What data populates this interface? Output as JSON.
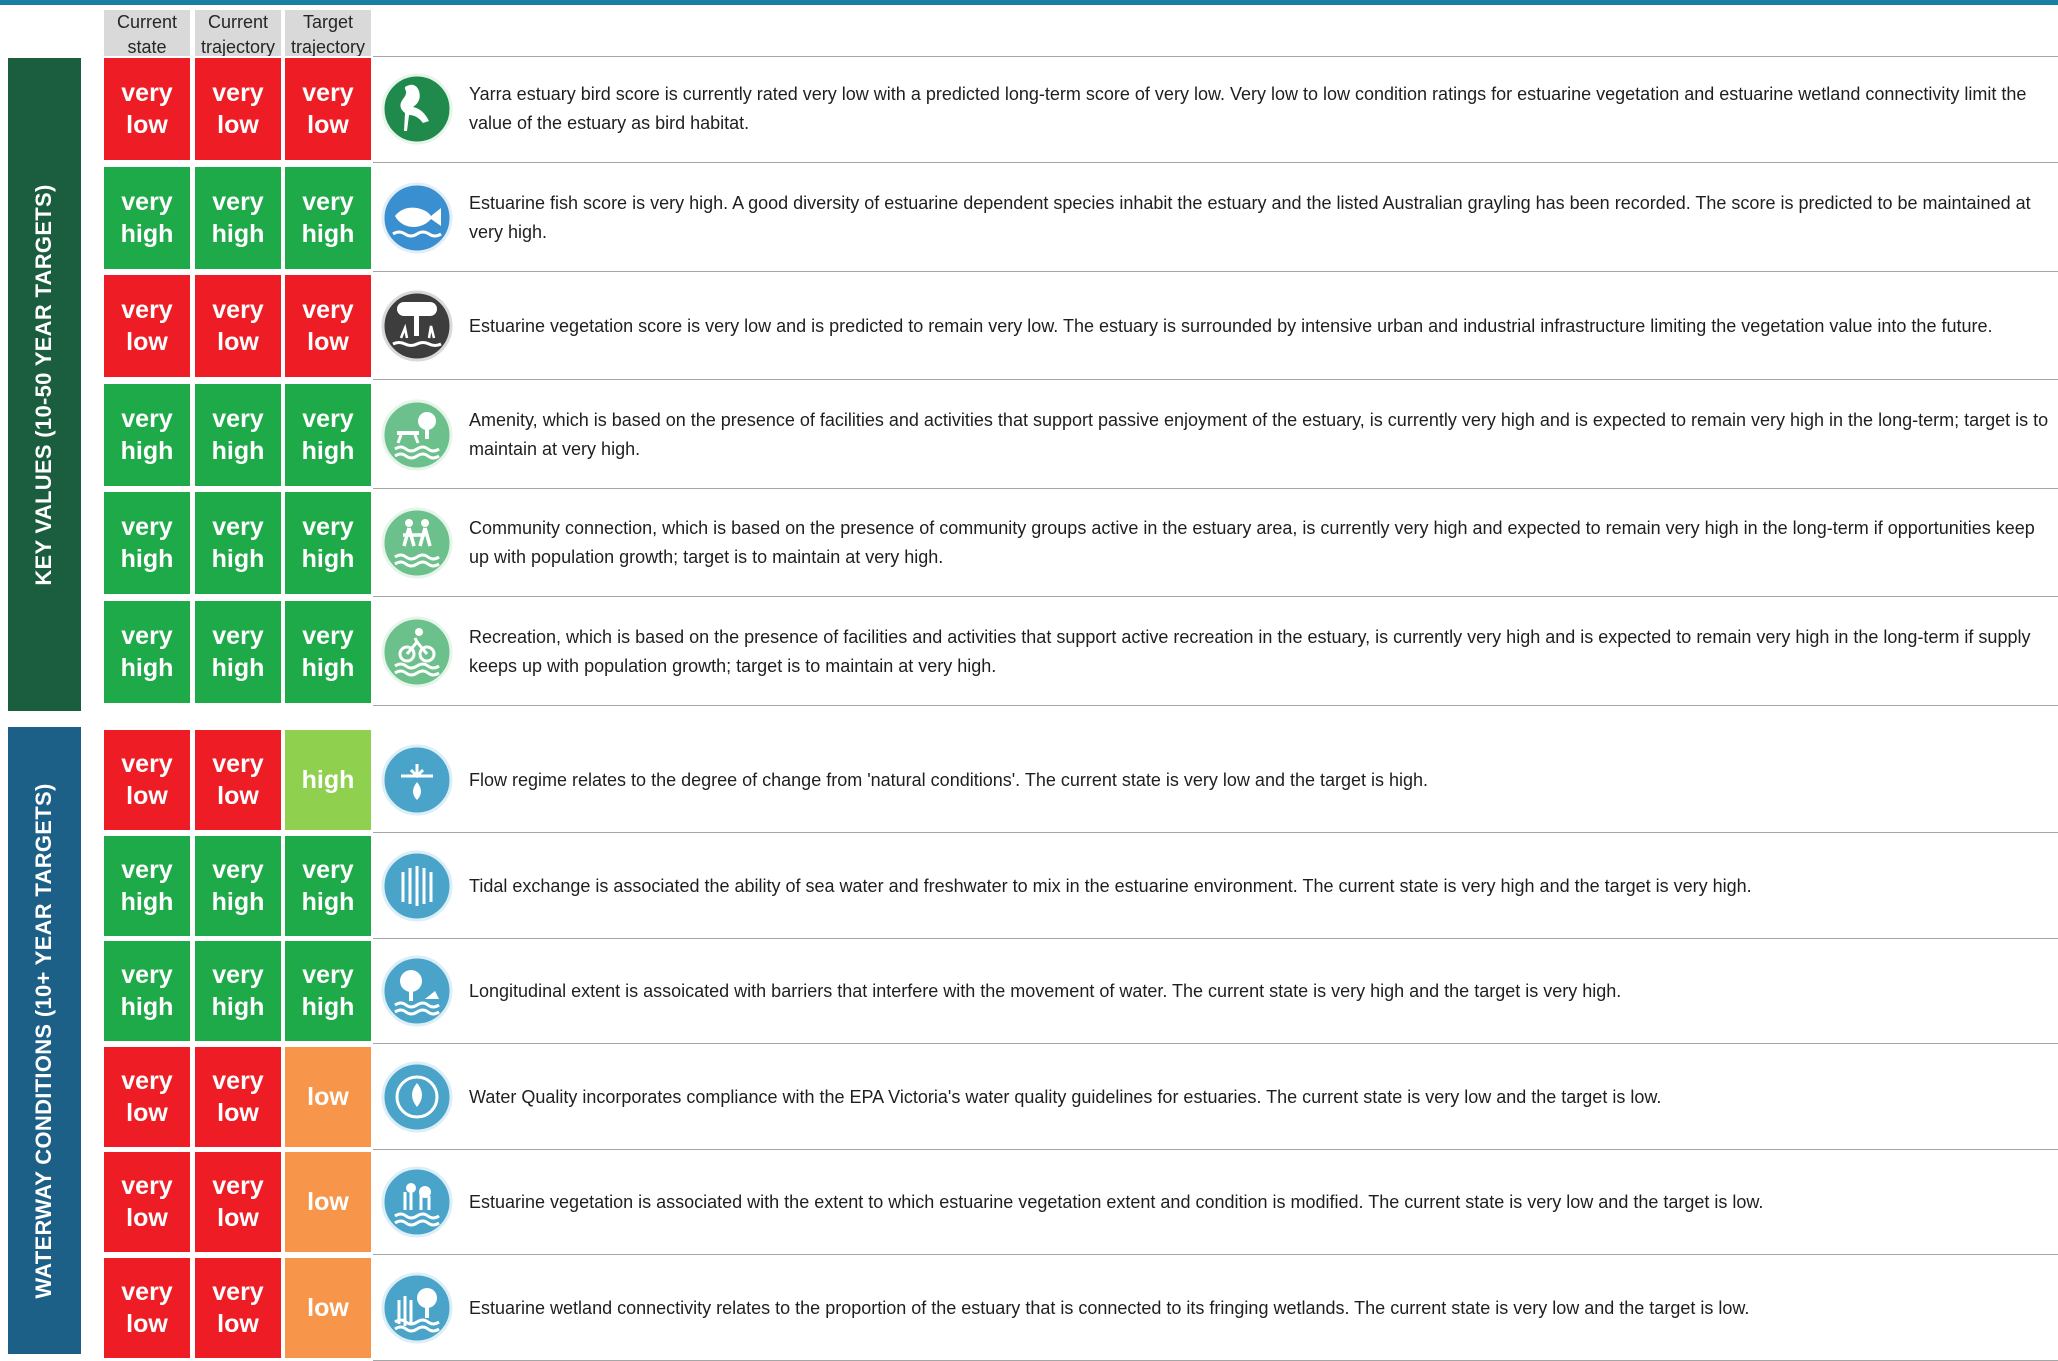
{
  "colors": {
    "top_bar": "#1a7fa0",
    "band_key_values": "#1b5e3f",
    "band_waterway": "#1c5f87",
    "very_low": "#ee1c24",
    "low": "#f7964a",
    "high": "#8fd14f",
    "very_high": "#1faa4a"
  },
  "headers": [
    {
      "label": "Current\nstate"
    },
    {
      "label": "Current\ntrajectory"
    },
    {
      "label": "Target\ntrajectory"
    }
  ],
  "sections": [
    {
      "label": "KEY VALUES (10-50 YEAR TARGETS)",
      "rows": [
        {
          "icon": "heron-bird-icon",
          "ratings": [
            "very\nlow",
            "very\nlow",
            "very\nlow"
          ],
          "levels": [
            "very_low",
            "very_low",
            "very_low"
          ],
          "text": "Yarra estuary bird score is currently rated very low with a predicted long-term score of very low. Very low to low condition ratings for estuarine vegetation and estuarine wetland connectivity limit the value of the estuary as bird habitat."
        },
        {
          "icon": "fish-icon",
          "ratings": [
            "very\nhigh",
            "very\nhigh",
            "very\nhigh"
          ],
          "levels": [
            "very_high",
            "very_high",
            "very_high"
          ],
          "text": "Estuarine fish score is very high. A good diversity of estuarine dependent species inhabit the estuary and the listed Australian grayling has been recorded. The score is predicted to be maintained at very high."
        },
        {
          "icon": "vegetation-tree-icon",
          "ratings": [
            "very\nlow",
            "very\nlow",
            "very\nlow"
          ],
          "levels": [
            "very_low",
            "very_low",
            "very_low"
          ],
          "text": "Estuarine vegetation score is very low and is predicted to remain very low. The estuary is surrounded by intensive urban and industrial infrastructure limiting the vegetation value into the future."
        },
        {
          "icon": "picnic-amenity-icon",
          "ratings": [
            "very\nhigh",
            "very\nhigh",
            "very\nhigh"
          ],
          "levels": [
            "very_high",
            "very_high",
            "very_high"
          ],
          "text": "Amenity, which is based on the presence of facilities and activities that support passive enjoyment of the estuary, is currently very high and is expected to remain very high in the long-term; target is to maintain at very high."
        },
        {
          "icon": "people-walking-icon",
          "ratings": [
            "very\nhigh",
            "very\nhigh",
            "very\nhigh"
          ],
          "levels": [
            "very_high",
            "very_high",
            "very_high"
          ],
          "text": "Community connection, which is based on the presence of community groups active in the estuary area, is currently very high and expected to remain very high in the long-term if opportunities keep up with population growth; target is to maintain at very high."
        },
        {
          "icon": "cyclist-icon",
          "ratings": [
            "very\nhigh",
            "very\nhigh",
            "very\nhigh"
          ],
          "levels": [
            "very_high",
            "very_high",
            "very_high"
          ],
          "text": "Recreation, which is based on the presence of facilities and activities that support active recreation in the estuary, is currently very high and is expected to remain very high in the long-term if supply keeps up with population growth; target is to maintain at very high."
        }
      ]
    },
    {
      "label": "WATERWAY CONDITIONS (10+ YEAR TARGETS)",
      "rows": [
        {
          "icon": "flow-regime-icon",
          "ratings": [
            "very\nlow",
            "very\nlow",
            "high"
          ],
          "levels": [
            "very_low",
            "very_low",
            "high"
          ],
          "text": "Flow regime relates to the degree of change from 'natural conditions'.  The current state is very low and the target is high."
        },
        {
          "icon": "tidal-exchange-icon",
          "ratings": [
            "very\nhigh",
            "very\nhigh",
            "very\nhigh"
          ],
          "levels": [
            "very_high",
            "very_high",
            "very_high"
          ],
          "text": "Tidal exchange is associated the ability of sea water and freshwater to mix in the estuarine environment. The current state is very high and the target is very high."
        },
        {
          "icon": "longitudinal-extent-icon",
          "ratings": [
            "very\nhigh",
            "very\nhigh",
            "very\nhigh"
          ],
          "levels": [
            "very_high",
            "very_high",
            "very_high"
          ],
          "text": "Longitudinal extent is assoicated with barriers that interfere with the movement of water.  The current state is very high and the target is very high."
        },
        {
          "icon": "water-drop-icon",
          "ratings": [
            "very\nlow",
            "very\nlow",
            "low"
          ],
          "levels": [
            "very_low",
            "very_low",
            "low"
          ],
          "text": "Water Quality incorporates compliance with the EPA Victoria's water quality guidelines for estuaries.  The current state is very low and the target is low."
        },
        {
          "icon": "estuarine-vegetation-icon",
          "ratings": [
            "very\nlow",
            "very\nlow",
            "low"
          ],
          "levels": [
            "very_low",
            "very_low",
            "low"
          ],
          "text": "Estuarine vegetation is associated with the extent to which estuarine vegetation extent and condition is modified.  The current state is very low and the target is low."
        },
        {
          "icon": "wetland-connectivity-icon",
          "ratings": [
            "very\nlow",
            "very\nlow",
            "low"
          ],
          "levels": [
            "very_low",
            "very_low",
            "low"
          ],
          "text": "Estuarine wetland connectivity relates to the proportion of the estuary that is connected to its fringing wetlands.  The current state is very low and the target is low."
        }
      ]
    }
  ]
}
